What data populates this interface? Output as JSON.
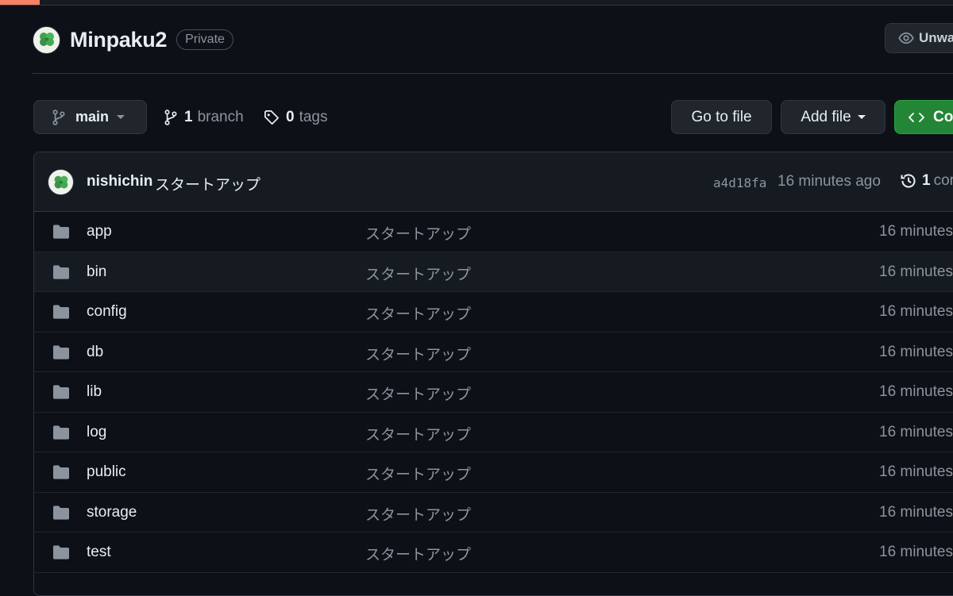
{
  "repo": {
    "name": "Minpaku2",
    "visibility": "Private",
    "watch_label": "Unwa"
  },
  "toolbar": {
    "branch": "main",
    "branch_count": "1",
    "branch_label": "branch",
    "tag_count": "0",
    "tag_label": "tags",
    "go_to_file": "Go to file",
    "add_file": "Add file",
    "code": "Co"
  },
  "latest_commit": {
    "author": "nishichin",
    "message": "スタートアップ",
    "sha": "a4d18fa",
    "time": "16 minutes ago",
    "commits_count": "1",
    "commits_label": "cor"
  },
  "files": [
    {
      "name": "app",
      "message": "スタートアップ",
      "time": "16 minutes"
    },
    {
      "name": "bin",
      "message": "スタートアップ",
      "time": "16 minutes"
    },
    {
      "name": "config",
      "message": "スタートアップ",
      "time": "16 minutes"
    },
    {
      "name": "db",
      "message": "スタートアップ",
      "time": "16 minutes"
    },
    {
      "name": "lib",
      "message": "スタートアップ",
      "time": "16 minutes"
    },
    {
      "name": "log",
      "message": "スタートアップ",
      "time": "16 minutes"
    },
    {
      "name": "public",
      "message": "スタートアップ",
      "time": "16 minutes"
    },
    {
      "name": "storage",
      "message": "スタートアップ",
      "time": "16 minutes"
    },
    {
      "name": "test",
      "message": "スタートアップ",
      "time": "16 minutes"
    }
  ],
  "colors": {
    "background": "#0d1117",
    "accent_green": "#238636",
    "progress": "#f78166",
    "muted_text": "#8b949e"
  },
  "icons": {
    "avatar": "clover-avatar-icon",
    "watch": "eye-icon",
    "branch": "git-branch-icon",
    "tag": "tag-icon",
    "code": "code-icon",
    "history": "history-icon",
    "folder": "folder-icon"
  }
}
